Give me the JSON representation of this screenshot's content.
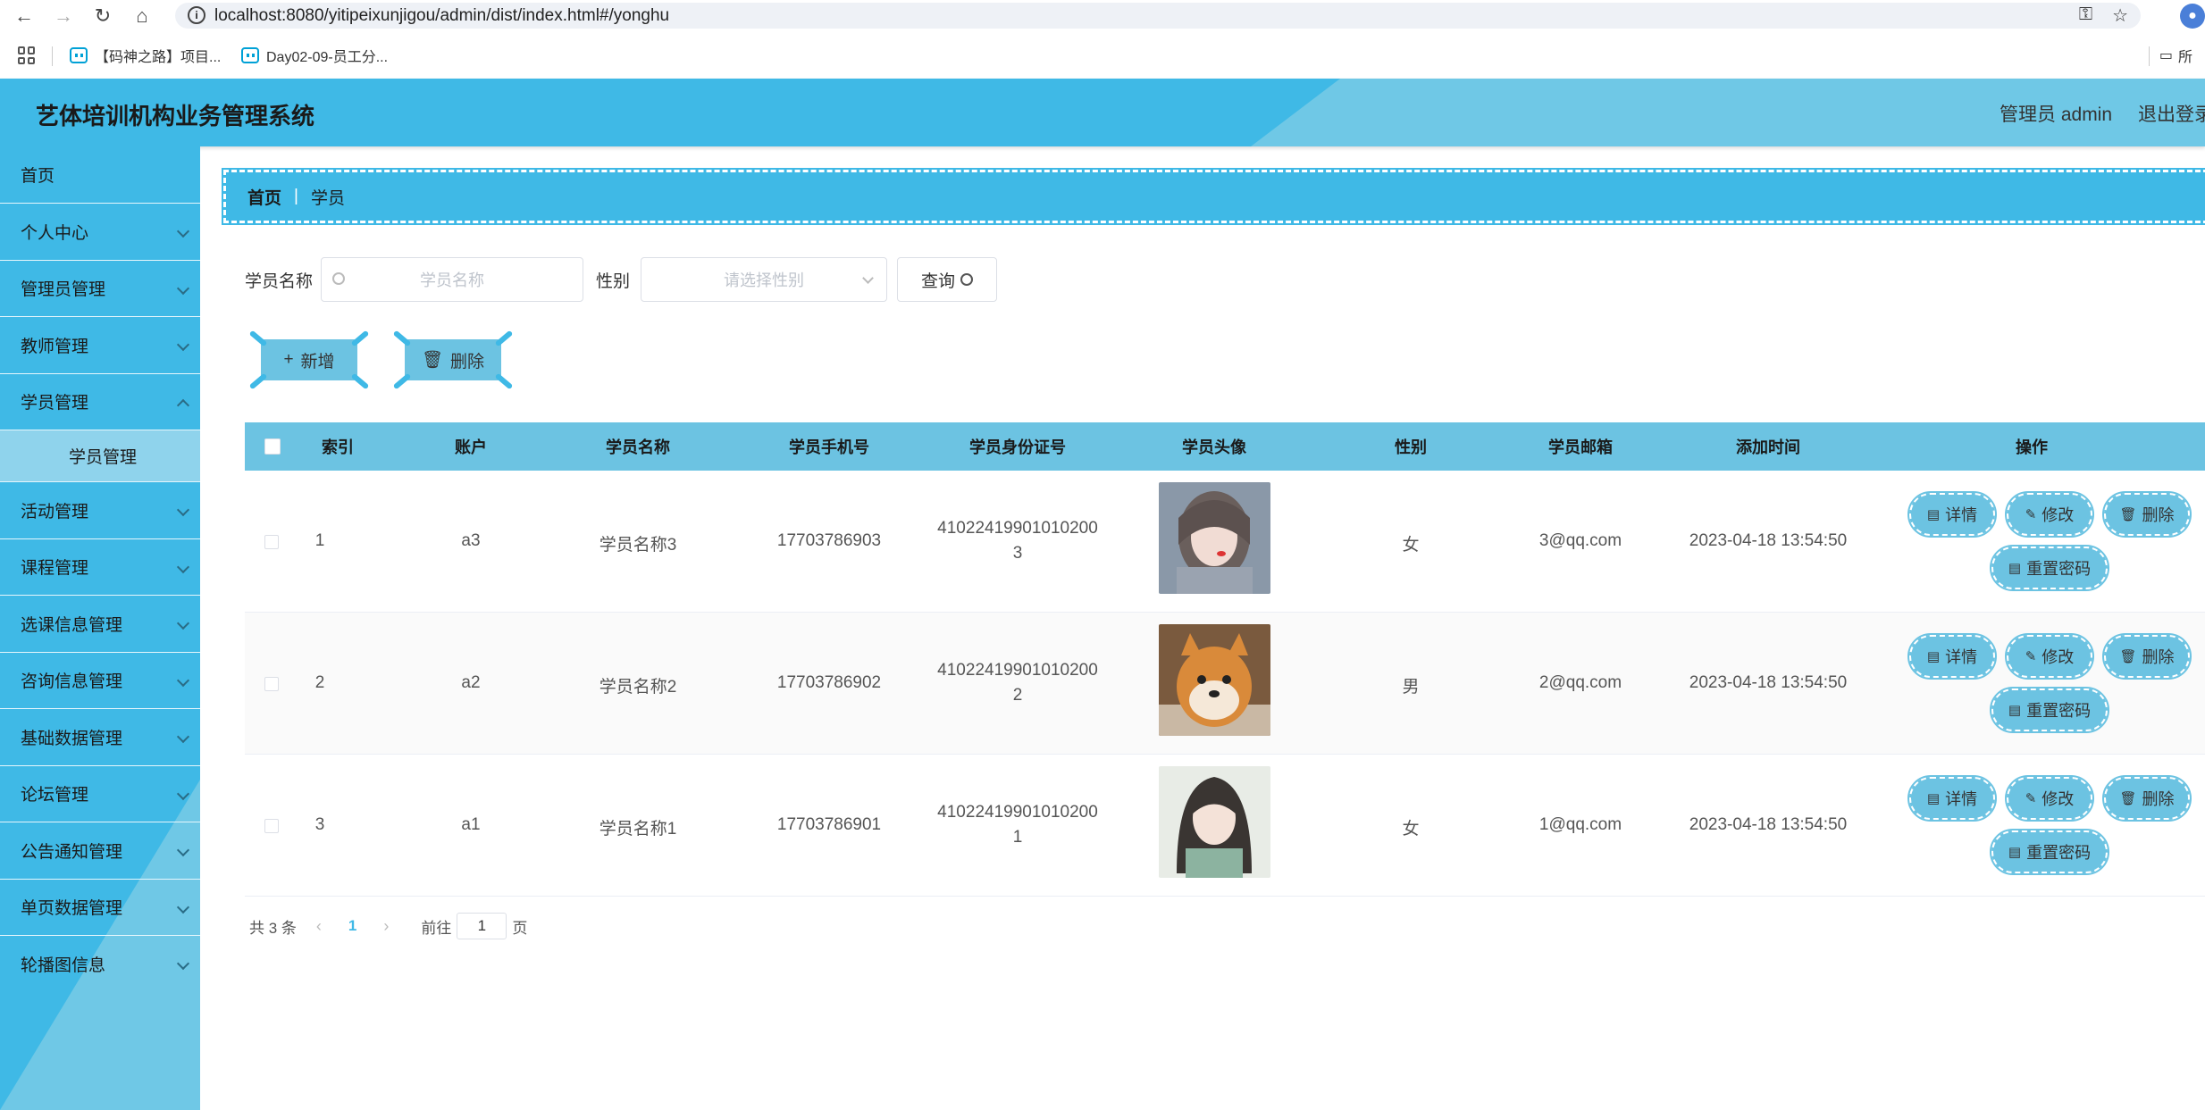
{
  "browser": {
    "url": "localhost:8080/yitipeixunjigou/admin/dist/index.html#/yonghu",
    "bookmarks": [
      "【码神之路】项目...",
      "Day02-09-员工分..."
    ],
    "folder_label": "所"
  },
  "header": {
    "title": "艺体培训机构业务管理系统",
    "user": "管理员 admin",
    "logout": "退出登录"
  },
  "sidebar": {
    "items": [
      {
        "label": "首页"
      },
      {
        "label": "个人中心"
      },
      {
        "label": "管理员管理"
      },
      {
        "label": "教师管理"
      },
      {
        "label": "学员管理",
        "expanded": true
      },
      {
        "label": "活动管理"
      },
      {
        "label": "课程管理"
      },
      {
        "label": "选课信息管理"
      },
      {
        "label": "咨询信息管理"
      },
      {
        "label": "基础数据管理"
      },
      {
        "label": "论坛管理"
      },
      {
        "label": "公告通知管理"
      },
      {
        "label": "单页数据管理"
      },
      {
        "label": "轮播图信息"
      }
    ],
    "subitem": "学员管理"
  },
  "breadcrumb": {
    "home": "首页",
    "separator": "|",
    "current": "学员"
  },
  "search": {
    "name_label": "学员名称",
    "name_placeholder": "学员名称",
    "gender_label": "性别",
    "gender_placeholder": "请选择性别",
    "query_button": "查询"
  },
  "actions": {
    "add": "新增",
    "delete": "删除"
  },
  "table": {
    "columns": [
      "索引",
      "账户",
      "学员名称",
      "学员手机号",
      "学员身份证号",
      "学员头像",
      "性别",
      "学员邮箱",
      "添加时间",
      "操作"
    ],
    "rows": [
      {
        "index": "1",
        "account": "a3",
        "name": "学员名称3",
        "phone": "17703786903",
        "id_line1": "41022419901010200",
        "id_line2": "3",
        "gender": "女",
        "email": "3@qq.com",
        "time": "2023-04-18 13:54:50",
        "avatar": "portrait-girl"
      },
      {
        "index": "2",
        "account": "a2",
        "name": "学员名称2",
        "phone": "17703786902",
        "id_line1": "41022419901010200",
        "id_line2": "2",
        "gender": "男",
        "email": "2@qq.com",
        "time": "2023-04-18 13:54:50",
        "avatar": "shiba-dog"
      },
      {
        "index": "3",
        "account": "a1",
        "name": "学员名称1",
        "phone": "17703786901",
        "id_line1": "41022419901010200",
        "id_line2": "1",
        "gender": "女",
        "email": "1@qq.com",
        "time": "2023-04-18 13:54:50",
        "avatar": "anime-girl"
      }
    ],
    "ops": {
      "detail": "详情",
      "edit": "修改",
      "delete": "删除",
      "reset": "重置密码"
    }
  },
  "pager": {
    "total": "共 3 条",
    "current": "1",
    "goto_prefix": "前往",
    "goto_value": "1",
    "goto_suffix": "页"
  },
  "colors": {
    "primary": "#3fb9e6",
    "button": "#6cc3e2",
    "sidebar_active": "#8fd3ec"
  }
}
